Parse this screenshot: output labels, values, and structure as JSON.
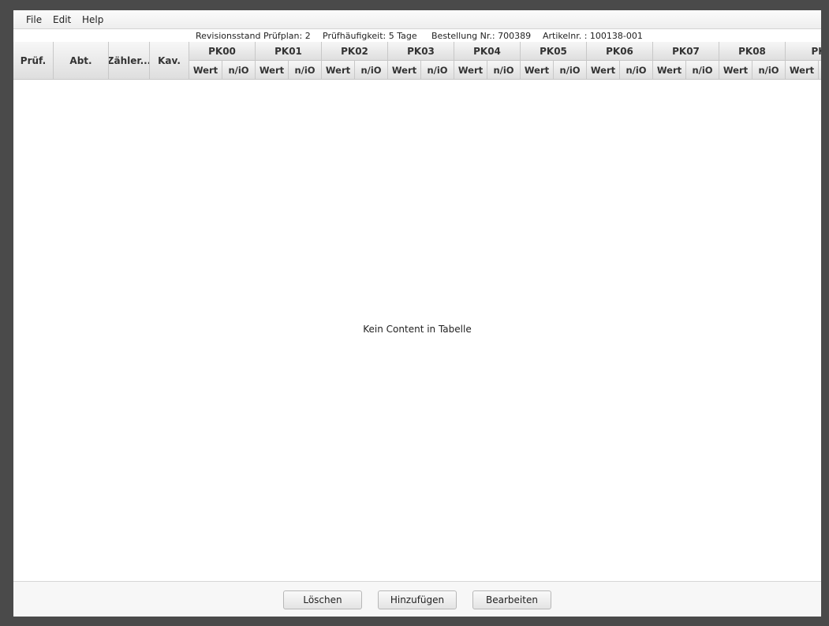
{
  "menu": {
    "file": "File",
    "edit": "Edit",
    "help": "Help"
  },
  "info": {
    "revision": "Revisionsstand Prüfplan:  2",
    "frequency": "Prüfhäufigkeit:  5 Tage",
    "order": "Bestellung Nr.:  700389",
    "article": "Artikelnr. :  100138-001"
  },
  "table": {
    "columns": {
      "pruef": "Prüf.",
      "abt": "Abt.",
      "zaehler": "Zähler...",
      "kav": "Kav."
    },
    "groups": [
      "PK00",
      "PK01",
      "PK02",
      "PK03",
      "PK04",
      "PK05",
      "PK06",
      "PK07",
      "PK08",
      "PK"
    ],
    "sub_wert": "Wert",
    "sub_nio": "n/iO",
    "placeholder": "Kein Content in Tabelle"
  },
  "buttons": {
    "delete": "Löschen",
    "add": "Hinzufügen",
    "edit": "Bearbeiten"
  }
}
